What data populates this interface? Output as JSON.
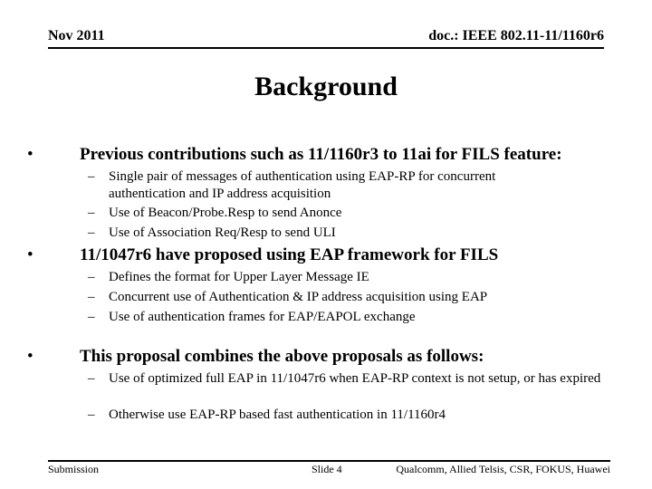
{
  "header": {
    "date": "Nov 2011",
    "doc_id": "doc.: IEEE 802.11-11/1160r6"
  },
  "title": "Background",
  "bullets": [
    {
      "icon": "bullet-dot",
      "text": "Previous contributions such as 11/1160r3 to 11ai for FILS feature:",
      "subitems": [
        "Single pair of messages of authentication using EAP-RP for concurrent authentication  and IP address acquisition",
        "Use of  Beacon/Probe.Resp to send Anonce",
        "Use of Association Req/Resp to send ULI"
      ]
    },
    {
      "icon": "bullet-dot",
      "text": "11/1047r6 have proposed using EAP framework for FILS",
      "subitems": [
        "Defines the format for Upper Layer Message IE",
        "Concurrent use of Authentication & IP address acquisition using EAP",
        "Use of authentication frames for EAP/EAPOL exchange"
      ]
    },
    {
      "icon": "bullet-dot",
      "text": "This proposal combines the above proposals as follows:",
      "subitems": [
        "Use of optimized full EAP in 11/1047r6 when EAP-RP context is not setup, or has expired",
        "Otherwise use EAP-RP based fast authentication in 11/1160r4"
      ]
    }
  ],
  "symbols": {
    "bullet": "•",
    "dash": "–"
  },
  "footer": {
    "left": "Submission",
    "center": "Slide 4",
    "right": "Qualcomm, Allied Telsis, CSR, FOKUS, Huawei"
  }
}
